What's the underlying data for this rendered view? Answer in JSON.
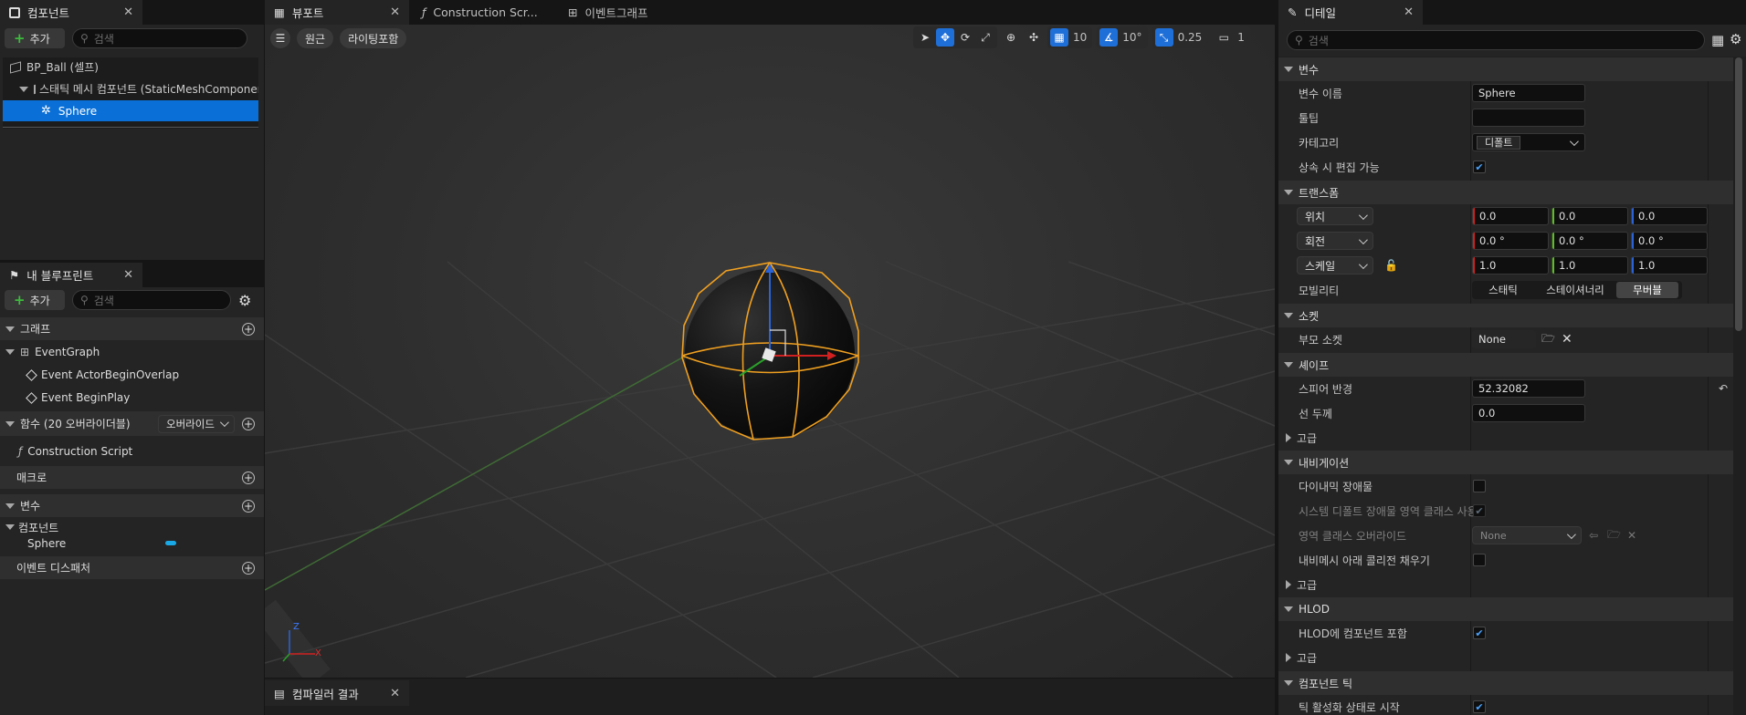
{
  "colors": {
    "accent": "#1f6fd8",
    "selection": "#0a70d8",
    "bg": "#151515",
    "panel": "#242424",
    "orange": "#f0a020"
  },
  "components": {
    "tab": "컴포넌트",
    "add": "추가",
    "search_placeholder": "검색",
    "tree": [
      {
        "label": "BP_Ball (셀프)",
        "icon": "blueprint-icon"
      },
      {
        "label": "스태틱 메시 컴포넌트 (StaticMeshComponent)",
        "icon": "static-mesh-icon"
      },
      {
        "label": "Sphere",
        "icon": "sphere-collision-icon"
      }
    ]
  },
  "my_blueprint": {
    "tab": "내 블루프린트",
    "add": "추가",
    "search_placeholder": "검색",
    "graphs_header": "그래프",
    "event_graph": "EventGraph",
    "events": [
      "Event ActorBeginOverlap",
      "Event BeginPlay"
    ],
    "functions_header": "함수 (20 오버라이더블)",
    "override_label": "오버라이드",
    "construction_script": "Construction Script",
    "macros_header": "매크로",
    "variables_header": "변수",
    "components_group": "컴포넌트",
    "var_sphere": "Sphere",
    "dispatchers_header": "이벤트 디스패처"
  },
  "tabs": {
    "viewport": "뷰포트",
    "construction": "Construction Scr...",
    "event_graph": "이벤트그래프"
  },
  "viewport": {
    "perspective": "원근",
    "lighting": "라이팅포함",
    "grid_snap": "10",
    "rot_snap": "10°",
    "scale_snap": "0.25",
    "camera_speed": "1",
    "axis_x": "X",
    "axis_z": "Z"
  },
  "compiler": {
    "tab": "컴파일러 결과"
  },
  "details": {
    "tab": "디테일",
    "search_placeholder": "검색",
    "variable": {
      "header": "변수",
      "name_label": "변수 이름",
      "name_value": "Sphere",
      "tooltip_label": "툴팁",
      "tooltip_value": "",
      "category_label": "카테고리",
      "category_value": "디폴트",
      "editable_label": "상속 시 편집 가능"
    },
    "transform": {
      "header": "트랜스폼",
      "location": "위치",
      "rotation": "회전",
      "scale": "스케일",
      "loc": [
        "0.0",
        "0.0",
        "0.0"
      ],
      "rot": [
        "0.0 °",
        "0.0 °",
        "0.0 °"
      ],
      "scl": [
        "1.0",
        "1.0",
        "1.0"
      ],
      "mobility_label": "모빌리티",
      "mobility": [
        "스태틱",
        "스테이셔너리",
        "무버블"
      ]
    },
    "sockets": {
      "header": "소켓",
      "parent_label": "부모 소켓",
      "parent_value": "None"
    },
    "shape": {
      "header": "셰이프",
      "radius_label": "스피어 반경",
      "radius_value": "52.32082",
      "line_label": "선 두께",
      "line_value": "0.0",
      "advanced": "고급"
    },
    "navigation": {
      "header": "내비게이션",
      "dynamic_label": "다이내믹 장애물",
      "default_area_label": "시스템 디폴트 장애물 영역 클래스 사용",
      "area_override_label": "영역 클래스 오버라이드",
      "area_override_value": "None",
      "fill_label": "내비메시 아래 콜리전 채우기",
      "advanced": "고급"
    },
    "hlod": {
      "header": "HLOD",
      "include_label": "HLOD에 컴포넌트 포함",
      "advanced": "고급"
    },
    "tick": {
      "header": "컴포넌트 틱",
      "start_label": "틱 활성화 상태로 시작"
    }
  }
}
